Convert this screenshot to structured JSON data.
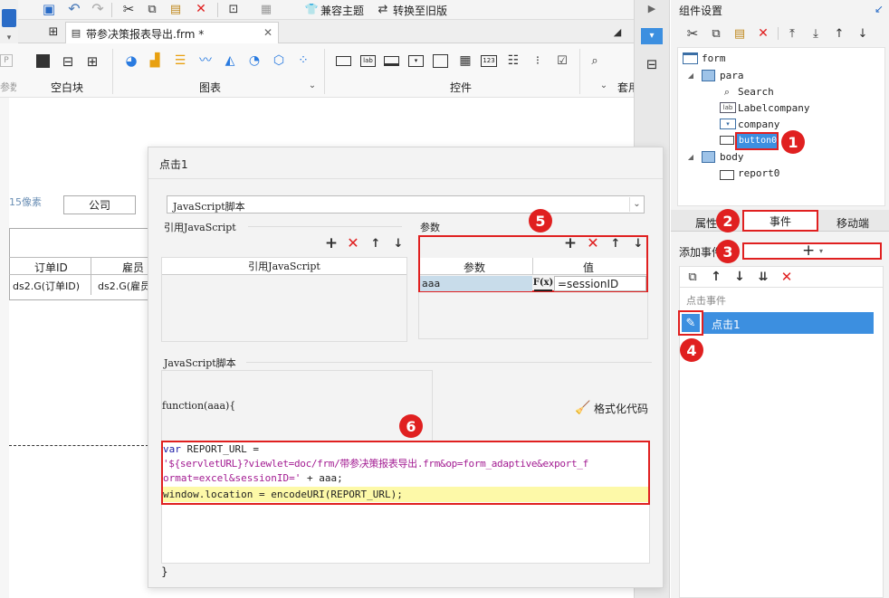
{
  "toolbar": {
    "theme_label": "兼容主题",
    "convert_label": "转换至旧版",
    "tab_title": "带参决策报表导出.frm *",
    "group_blank": "空白块",
    "group_charts": "图表",
    "group_widgets": "控件",
    "group_cut_left": "参数",
    "group_cut_right": "套用",
    "num_widget": "123",
    "lab_widget": "lab"
  },
  "canvas": {
    "pixel_hint": "15像素",
    "company_label": "公司",
    "col_order_id": "订单ID",
    "col_employee": "雇员",
    "cell_order": "ds2.G(订单ID)",
    "cell_employee": "ds2.G(雇员"
  },
  "dialog": {
    "title": "点击1",
    "script_type": "JavaScript脚本",
    "ref_js_section": "引用JavaScript",
    "ref_js_header": "引用JavaScript",
    "params_section": "参数",
    "param_col_name": "参数",
    "param_col_value": "值",
    "param_name": "aaa",
    "param_value": "=sessionID",
    "script_section": "JavaScript脚本",
    "function_sig": "function(aaa){",
    "format_code": "格式化代码",
    "code_kw": "var",
    "code_l1_rest": " REPORT_URL =",
    "code_l2": "'${servletURL}?viewlet=doc/frm/带参决策报表导出.frm&op=form_adaptive&export_f",
    "code_l3_str": "ormat=excel&sessionID='",
    "code_l3_rest": " + aaa;",
    "code_l4": "window.location = encodeURI(REPORT_URL);",
    "closing_brace": "}"
  },
  "panel": {
    "title": "组件设置",
    "tree": {
      "form": "form",
      "para": "para",
      "search": "Search",
      "labelcompany": "Labelcompany",
      "company": "company",
      "button0": "button0",
      "body": "body",
      "report0": "report0"
    },
    "tabs": {
      "attributes": "属性",
      "events": "事件",
      "mobile": "移动端"
    },
    "add_event_label": "添加事件",
    "add_event_plus": "+",
    "event_list_header": "点击事件",
    "event_item": "点击1",
    "lab_icon_text": "lab"
  },
  "badges": {
    "b1": "1",
    "b2": "2",
    "b3": "3",
    "b4": "4",
    "b5": "5",
    "b6": "6"
  },
  "colors": {
    "accent_red": "#e02020",
    "selection_blue": "#3c8fe0",
    "code_highlight": "#fdf9a8",
    "panel_bg": "#f3f3f3",
    "param_row_bg": "#c8dcea"
  }
}
